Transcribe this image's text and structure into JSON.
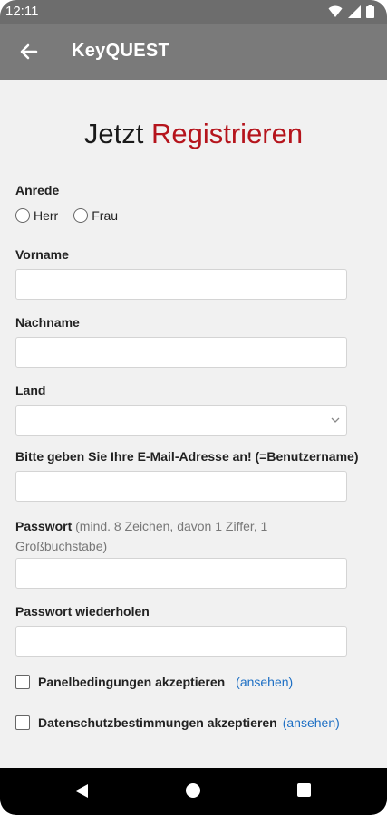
{
  "status": {
    "time": "12:11"
  },
  "appbar": {
    "title": "KeyQUEST"
  },
  "heading": {
    "part1": "Jetzt",
    "part2": "Registrieren",
    "accent_color": "#b5141c"
  },
  "form": {
    "salutation_label": "Anrede",
    "salutation_options": [
      "Herr",
      "Frau"
    ],
    "firstname_label": "Vorname",
    "lastname_label": "Nachname",
    "country_label": "Land",
    "email_label": "Bitte geben Sie Ihre E-Mail-Adresse an! (=Benutzername)",
    "password_label": "Passwort",
    "password_hint": "(mind. 8 Zeichen, davon 1 Ziffer, 1 Großbuchstabe)",
    "password_repeat_label": "Passwort wiederholen",
    "terms_label": "Panelbedingungen akzeptieren",
    "terms_link": "(ansehen)",
    "privacy_label": "Datenschutzbestimmungen akzeptieren",
    "privacy_link": "(ansehen)"
  },
  "icons": {
    "back": "arrow-left-icon",
    "wifi": "wifi-icon",
    "signal": "signal-icon",
    "battery": "battery-icon",
    "dropdown": "chevron-down-icon",
    "nav_back": "nav-back-triangle-icon",
    "nav_home": "nav-home-circle-icon",
    "nav_recent": "nav-recent-square-icon"
  }
}
